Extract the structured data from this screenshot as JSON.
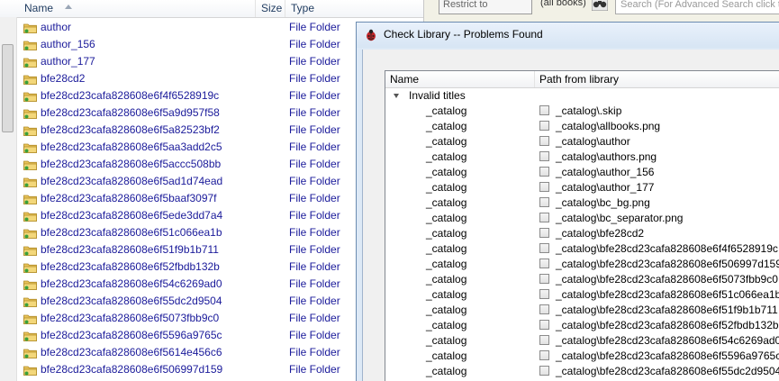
{
  "explorer": {
    "columns": {
      "name": "Name",
      "size": "Size",
      "type": "Type"
    },
    "rows": [
      {
        "name": "author",
        "type": "File Folder"
      },
      {
        "name": "author_156",
        "type": "File Folder"
      },
      {
        "name": "author_177",
        "type": "File Folder"
      },
      {
        "name": "bfe28cd2",
        "type": "File Folder"
      },
      {
        "name": "bfe28cd23cafa828608e6f4f6528919c",
        "type": "File Folder"
      },
      {
        "name": "bfe28cd23cafa828608e6f5a9d957f58",
        "type": "File Folder"
      },
      {
        "name": "bfe28cd23cafa828608e6f5a82523bf2",
        "type": "File Folder"
      },
      {
        "name": "bfe28cd23cafa828608e6f5aa3add2c5",
        "type": "File Folder"
      },
      {
        "name": "bfe28cd23cafa828608e6f5accc508bb",
        "type": "File Folder"
      },
      {
        "name": "bfe28cd23cafa828608e6f5ad1d74ead",
        "type": "File Folder"
      },
      {
        "name": "bfe28cd23cafa828608e6f5baaf3097f",
        "type": "File Folder"
      },
      {
        "name": "bfe28cd23cafa828608e6f5ede3dd7a4",
        "type": "File Folder"
      },
      {
        "name": "bfe28cd23cafa828608e6f51c066ea1b",
        "type": "File Folder"
      },
      {
        "name": "bfe28cd23cafa828608e6f51f9b1b711",
        "type": "File Folder"
      },
      {
        "name": "bfe28cd23cafa828608e6f52fbdb132b",
        "type": "File Folder"
      },
      {
        "name": "bfe28cd23cafa828608e6f54c6269ad0",
        "type": "File Folder"
      },
      {
        "name": "bfe28cd23cafa828608e6f55dc2d9504",
        "type": "File Folder"
      },
      {
        "name": "bfe28cd23cafa828608e6f5073fbb9c0",
        "type": "File Folder"
      },
      {
        "name": "bfe28cd23cafa828608e6f5596a9765c",
        "type": "File Folder"
      },
      {
        "name": "bfe28cd23cafa828608e6f5614e456c6",
        "type": "File Folder"
      },
      {
        "name": "bfe28cd23cafa828608e6f506997d159",
        "type": "File Folder"
      }
    ]
  },
  "toolbar": {
    "restrict_label": "Restrict to",
    "all_books": "(all books)",
    "search_placeholder": "Search (For Advanced Search click the"
  },
  "dialog": {
    "title": "Check Library -- Problems Found",
    "columns": {
      "name": "Name",
      "path": "Path from library"
    },
    "group_label": "Invalid titles",
    "items": [
      {
        "name": "_catalog",
        "path": "_catalog\\.skip"
      },
      {
        "name": "_catalog",
        "path": "_catalog\\allbooks.png"
      },
      {
        "name": "_catalog",
        "path": "_catalog\\author"
      },
      {
        "name": "_catalog",
        "path": "_catalog\\authors.png"
      },
      {
        "name": "_catalog",
        "path": "_catalog\\author_156"
      },
      {
        "name": "_catalog",
        "path": "_catalog\\author_177"
      },
      {
        "name": "_catalog",
        "path": "_catalog\\bc_bg.png"
      },
      {
        "name": "_catalog",
        "path": "_catalog\\bc_separator.png"
      },
      {
        "name": "_catalog",
        "path": "_catalog\\bfe28cd2"
      },
      {
        "name": "_catalog",
        "path": "_catalog\\bfe28cd23cafa828608e6f4f6528919c"
      },
      {
        "name": "_catalog",
        "path": "_catalog\\bfe28cd23cafa828608e6f506997d159"
      },
      {
        "name": "_catalog",
        "path": "_catalog\\bfe28cd23cafa828608e6f5073fbb9c0"
      },
      {
        "name": "_catalog",
        "path": "_catalog\\bfe28cd23cafa828608e6f51c066ea1b"
      },
      {
        "name": "_catalog",
        "path": "_catalog\\bfe28cd23cafa828608e6f51f9b1b711"
      },
      {
        "name": "_catalog",
        "path": "_catalog\\bfe28cd23cafa828608e6f52fbdb132b"
      },
      {
        "name": "_catalog",
        "path": "_catalog\\bfe28cd23cafa828608e6f54c6269ad0"
      },
      {
        "name": "_catalog",
        "path": "_catalog\\bfe28cd23cafa828608e6f5596a9765c"
      },
      {
        "name": "_catalog",
        "path": "_catalog\\bfe28cd23cafa828608e6f55dc2d9504"
      }
    ]
  }
}
